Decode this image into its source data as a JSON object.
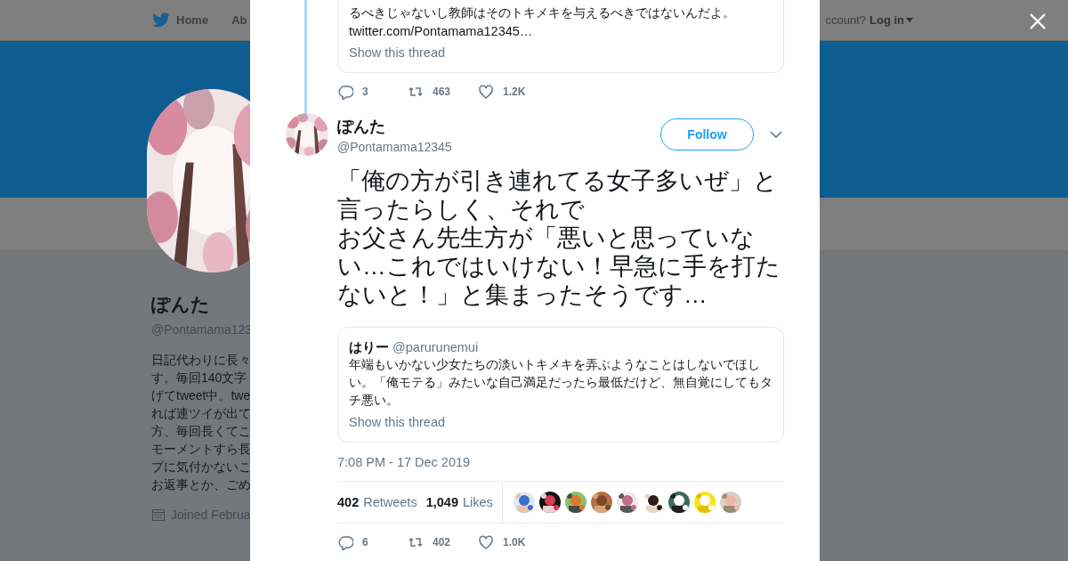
{
  "background_page": {
    "nav": [
      {
        "label": "Home"
      },
      {
        "label": "Ab"
      }
    ],
    "login_prompt": "ccount?",
    "login": "Log in",
    "profile": {
      "name": "ぽんた",
      "handle": "@Pontamama123",
      "bio_lines": [
        "日記代わりに長々",
        "す。毎回140文字",
        "げてtweet中。twe",
        "れば連ツイが出て",
        "方、毎回長くてこ",
        "モーメントすら長",
        "プに気付かないこ",
        "お返事とか、ごめ"
      ],
      "joined": "Joined Februa"
    }
  },
  "previous_tweet": {
    "quote": {
      "lines": [
        "るべきじゃないし教師はそのトキメキを与えるべきではないんだよ。"
      ],
      "link": "twitter.com/Pontamama12345…",
      "show_thread": "Show this thread"
    },
    "replies": "3",
    "retweets": "463",
    "likes": "1.2K"
  },
  "tweet": {
    "name": "ぽんた",
    "handle": "@Pontamama12345",
    "follow": "Follow",
    "paragraphs": [
      "「俺の方が引き連れてる女子多いぜ」と言ったらしく、それで",
      "お父さん先生方が「悪いと思っていない…これではいけない！早急に手を打たないと！」と集まったそうです…"
    ],
    "quote": {
      "name": "はりー",
      "handle": "@parurunemui",
      "text": "年端もいかない少女たちの淡いトキメキを弄ぶようなことはしないでほしい。「俺モテる」みたいな自己満足だったら最低だけど、無自覚にしてもタチ悪い。",
      "show_thread": "Show this thread"
    },
    "time": "7:08 PM - 17 Dec 2019",
    "retweet_count": "402",
    "retweet_label": "Retweets",
    "like_count": "1,049",
    "like_label": "Likes",
    "replies": "6",
    "retweets": "402",
    "likes": "1.0K"
  }
}
